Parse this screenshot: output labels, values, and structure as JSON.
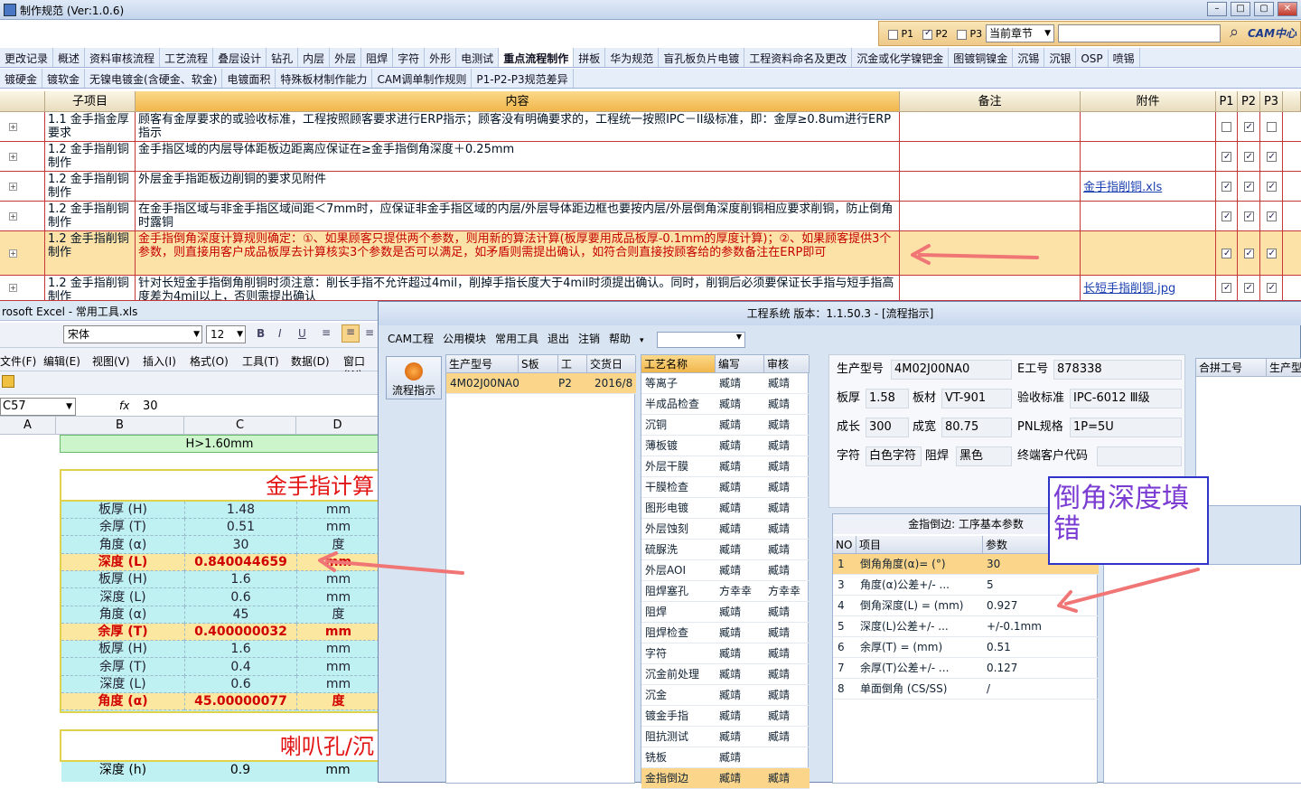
{
  "window": {
    "title": "制作规范 (Ver:1.0.6)"
  },
  "toolstrip": {
    "p1": "P1",
    "p2": "P2",
    "p3": "P3",
    "scope": "当前章节",
    "logo": "CAM中心"
  },
  "tabs_row1": [
    "更改记录",
    "概述",
    "资料审核流程",
    "工艺流程",
    "叠层设计",
    "钻孔",
    "内层",
    "外层",
    "阻焊",
    "字符",
    "外形",
    "电测试",
    "重点流程制作",
    "拼板",
    "华为规范",
    "盲孔板负片电镀",
    "工程资料命名及更改",
    "沉金或化学镍钯金",
    "图镀铜镍金",
    "沉锡",
    "沉银",
    "OSP",
    "喷锡"
  ],
  "tabs_row2": [
    "镀硬金",
    "镀软金",
    "无镍电镀金(含硬金、软金)",
    "电镀面积",
    "特殊板材制作能力",
    "CAM调单制作规则",
    "P1-P2-P3规范差异"
  ],
  "grid": {
    "headers": {
      "item": "子项目",
      "content": "内容",
      "remark": "备注",
      "attach": "附件",
      "p1": "P1",
      "p2": "P2",
      "p3": "P3"
    },
    "rows": [
      {
        "item": "1.1 金手指金厚要求",
        "content": "顾客有金厚要求的或验收标准，工程按照顾客要求进行ERP指示；顾客没有明确要求的，工程统一按照IPC－II级标准，即：金厚≥0.8um进行ERP指示",
        "attach": ""
      },
      {
        "item": "1.2 金手指削铜制作",
        "content": "金手指区域的内层导体距板边距离应保证在≥金手指倒角深度＋0.25mm",
        "attach": ""
      },
      {
        "item": "1.2 金手指削铜制作",
        "content": "外层金手指距板边削铜的要求见附件",
        "attach": "金手指削铜.xls"
      },
      {
        "item": "1.2 金手指削铜制作",
        "content": "在金手指区域与非金手指区域间距＜7mm时，应保证非金手指区域的内层/外层导体距边框也要按内层/外层倒角深度削铜相应要求削铜，防止倒角时露铜",
        "attach": ""
      },
      {
        "item": "1.2 金手指削铜制作",
        "content": "金手指倒角深度计算规则确定：①、如果顾客只提供两个参数，则用新的算法计算(板厚要用成品板厚-0.1mm的厚度计算)；②、如果顾客提供3个参数，则直接用客户成品板厚去计算核实3个参数是否可以满足，如矛盾则需提出确认，如符合则直接按顾客给的参数备注在ERP即可",
        "attach": ""
      },
      {
        "item": "1.2 金手指削铜制作",
        "content": "针对长短金手指倒角削铜时须注意：削长手指不允许超过4mil，削掉手指长度大于4mil时须提出确认。同时，削铜后必须要保证长手指与短手指高度差为4mil以上，否则需提出确认",
        "attach": "长短手指削铜.jpg"
      }
    ]
  },
  "excel": {
    "title": "rosoft Excel - 常用工具.xls",
    "font": "宋体",
    "size": "12",
    "menus": [
      "文件(F)",
      "编辑(E)",
      "视图(V)",
      "插入(I)",
      "格式(O)",
      "工具(T)",
      "数据(D)",
      "窗口(W)"
    ],
    "cellref": "C57",
    "fx": "fx",
    "formula": "30",
    "cols": [
      "A",
      "B",
      "C",
      "D"
    ],
    "condition": "H>1.60mm",
    "calc_title": "金手指计算",
    "rows": [
      {
        "label": "板厚 (H)",
        "value": "1.48",
        "unit": "mm",
        "hl": false
      },
      {
        "label": "余厚 (T)",
        "value": "0.51",
        "unit": "mm",
        "hl": false
      },
      {
        "label": "角度 (α)",
        "value": "30",
        "unit": "度",
        "hl": false
      },
      {
        "label": "深度 (L)",
        "value": "0.840044659",
        "unit": "mm",
        "hl": true
      },
      {
        "label": "板厚 (H)",
        "value": "1.6",
        "unit": "mm",
        "hl": false
      },
      {
        "label": "深度 (L)",
        "value": "0.6",
        "unit": "mm",
        "hl": false
      },
      {
        "label": "角度 (α)",
        "value": "45",
        "unit": "度",
        "hl": false
      },
      {
        "label": "余厚 (T)",
        "value": "0.400000032",
        "unit": "mm",
        "hl": true
      },
      {
        "label": "板厚 (H)",
        "value": "1.6",
        "unit": "mm",
        "hl": false
      },
      {
        "label": "余厚 (T)",
        "value": "0.4",
        "unit": "mm",
        "hl": false
      },
      {
        "label": "深度 (L)",
        "value": "0.6",
        "unit": "mm",
        "hl": false
      },
      {
        "label": "角度 (α)",
        "value": "45.00000077",
        "unit": "度",
        "hl": true
      }
    ],
    "calc2_title": "喇叭孔/沉",
    "row_last": {
      "label": "深度 (h)",
      "value": "0.9",
      "unit": "mm"
    }
  },
  "cam": {
    "title": "工程系统  版本：1.1.50.3 - [流程指示]",
    "menus": [
      "CAM工程",
      "公用模块",
      "常用工具",
      "退出",
      "注销",
      "帮助"
    ],
    "side_button": "流程指示",
    "jobs": {
      "headers": [
        "生产型号",
        "S板",
        "工",
        "交货日"
      ],
      "row": [
        "4M02J00NA0",
        "P2",
        "2016/8"
      ]
    },
    "procs": {
      "headers": [
        "工艺名称",
        "编写",
        "审核"
      ],
      "rows": [
        [
          "等离子",
          "臧靖",
          "臧靖"
        ],
        [
          "半成品检查",
          "臧靖",
          "臧靖"
        ],
        [
          "沉铜",
          "臧靖",
          "臧靖"
        ],
        [
          "薄板镀",
          "臧靖",
          "臧靖"
        ],
        [
          "外层干膜",
          "臧靖",
          "臧靖"
        ],
        [
          "干膜检查",
          "臧靖",
          "臧靖"
        ],
        [
          "图形电镀",
          "臧靖",
          "臧靖"
        ],
        [
          "外层蚀刻",
          "臧靖",
          "臧靖"
        ],
        [
          "硫脲洗",
          "臧靖",
          "臧靖"
        ],
        [
          "外层AOI",
          "臧靖",
          "臧靖"
        ],
        [
          "阻焊塞孔",
          "方幸幸",
          "方幸幸"
        ],
        [
          "阻焊",
          "臧靖",
          "臧靖"
        ],
        [
          "阻焊检查",
          "臧靖",
          "臧靖"
        ],
        [
          "字符",
          "臧靖",
          "臧靖"
        ],
        [
          "沉金前处理",
          "臧靖",
          "臧靖"
        ],
        [
          "沉金",
          "臧靖",
          "臧靖"
        ],
        [
          "镀金手指",
          "臧靖",
          "臧靖"
        ],
        [
          "阻抗测试",
          "臧靖",
          "臧靖"
        ],
        [
          "铣板",
          "臧靖",
          ""
        ],
        [
          "金指倒边",
          "臧靖",
          "臧靖"
        ]
      ]
    },
    "info": {
      "prod_no_label": "生产型号",
      "prod_no": "4M02J00NA0",
      "e_no_label": "E工号",
      "e_no": "878338",
      "thick_label": "板厚",
      "thick": "1.58",
      "mat_label": "板材",
      "mat": "VT-901",
      "std_label": "验收标准",
      "std": "IPC-6012 Ⅲ级",
      "len_label": "成长",
      "len": "300",
      "wid_label": "成宽",
      "wid": "80.75",
      "pnl_label": "PNL规格",
      "pnl": "1P=5U",
      "char_label": "字符",
      "char": "白色字符",
      "mask_label": "阻焊",
      "mask": "黑色",
      "cust_label": "终端客户代码",
      "cust": ""
    },
    "merge_headers": [
      "合拼工号",
      "生产型"
    ],
    "params": {
      "title": "金指倒边: 工序基本参数",
      "headers": [
        "NO",
        "项目",
        "参数"
      ],
      "rows": [
        [
          "1",
          "倒角角度(α)= (°)",
          "30"
        ],
        [
          "3",
          "角度(α)公差+/- ...",
          "5"
        ],
        [
          "4",
          "倒角深度(L) = (mm)",
          "0.927"
        ],
        [
          "5",
          "深度(L)公差+/- ...",
          "+/-0.1mm"
        ],
        [
          "6",
          "余厚(T) = (mm)",
          "0.51"
        ],
        [
          "7",
          "余厚(T)公差+/- ...",
          "0.127"
        ],
        [
          "8",
          "单面倒角 (CS/SS)",
          "/"
        ]
      ]
    }
  },
  "annotation": {
    "text": "倒角深度填错",
    "color": "#7a3bd2",
    "arrow_color": "#f07575"
  }
}
